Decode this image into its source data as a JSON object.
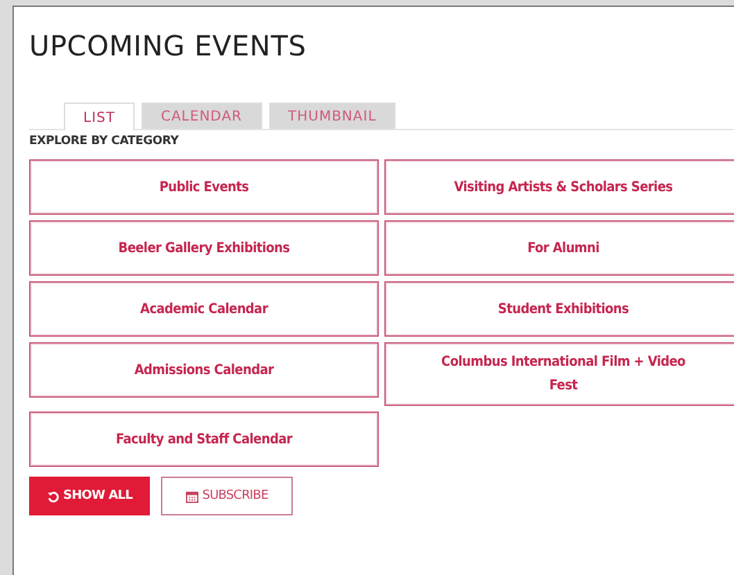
{
  "title": "UPCOMING EVENTS",
  "tabs": [
    {
      "label": "LIST",
      "selected": true
    },
    {
      "label": "CALENDAR",
      "selected": false
    },
    {
      "label": "THUMBNAIL",
      "selected": false
    }
  ],
  "section_label": "EXPLORE BY CATEGORY",
  "categories": [
    "Public Events",
    "Visiting Artists & Scholars Series",
    "Beeler Gallery Exhibitions",
    "For Alumni",
    "Academic Calendar",
    "Student Exhibitions",
    "Admissions Calendar",
    "Columbus International Film + Video Fest",
    "Faculty and Staff Calendar"
  ],
  "buttons": [
    {
      "kind": "primary",
      "label": "SHOW ALL"
    },
    {
      "kind": "secondary",
      "label": "SUBSCRIBE"
    }
  ]
}
